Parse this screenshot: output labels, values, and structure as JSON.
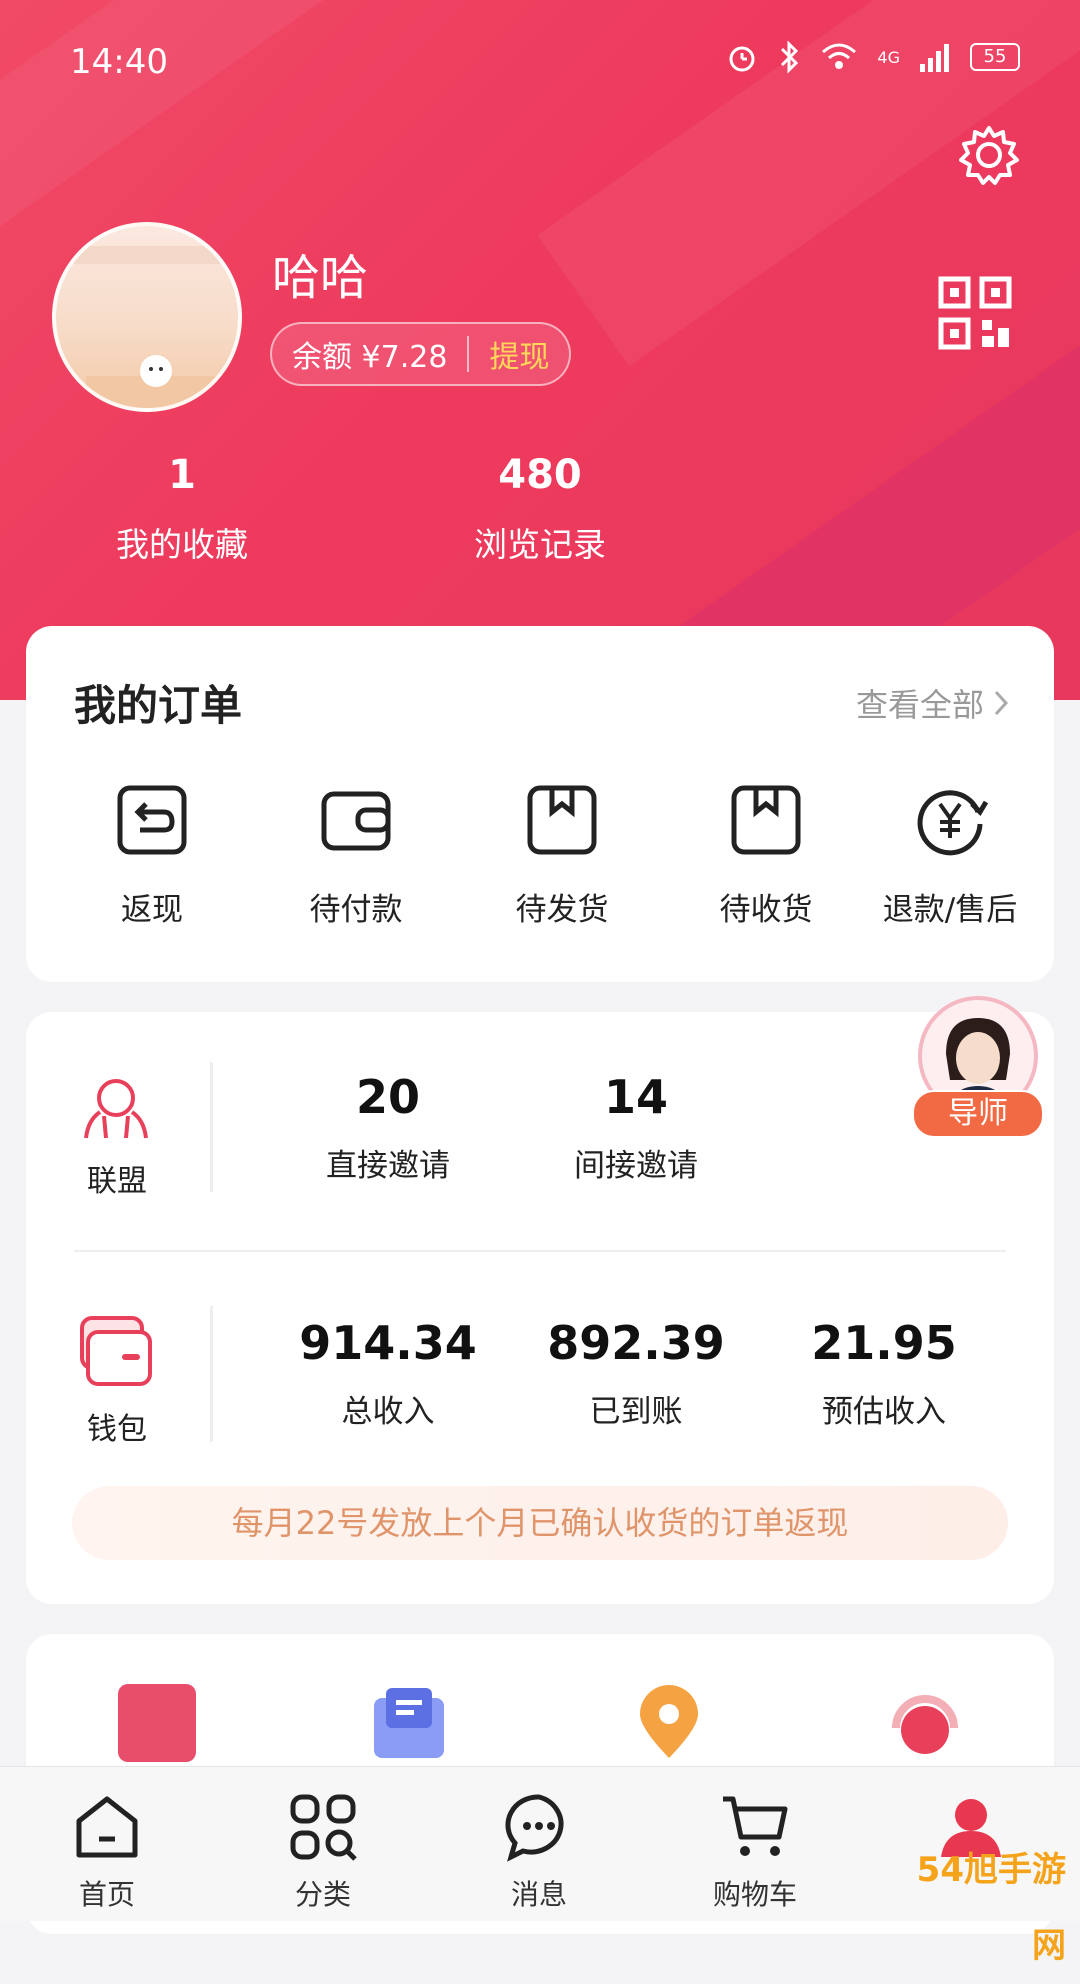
{
  "status_bar": {
    "time": "14:40",
    "battery": "55",
    "network": "4G"
  },
  "profile": {
    "username": "哈哈",
    "balance_label": "余额 ¥7.28",
    "withdraw_label": "提现",
    "stats": [
      {
        "value": "1",
        "label": "我的收藏"
      },
      {
        "value": "480",
        "label": "浏览记录"
      }
    ]
  },
  "orders": {
    "title": "我的订单",
    "view_all": "查看全部",
    "items": [
      {
        "label": "返现",
        "icon": "cashback-icon"
      },
      {
        "label": "待付款",
        "icon": "wallet-icon"
      },
      {
        "label": "待发货",
        "icon": "box-icon"
      },
      {
        "label": "待收货",
        "icon": "box-icon"
      },
      {
        "label": "退款/售后",
        "icon": "refund-icon"
      }
    ]
  },
  "league": {
    "label": "联盟",
    "metrics": [
      {
        "value": "20",
        "label": "直接邀请"
      },
      {
        "value": "14",
        "label": "间接邀请"
      }
    ],
    "mentor_label": "导师"
  },
  "wallet": {
    "label": "钱包",
    "metrics": [
      {
        "value": "914.34",
        "label": "总收入"
      },
      {
        "value": "892.39",
        "label": "已到账"
      },
      {
        "value": "21.95",
        "label": "预估收入"
      }
    ],
    "notice": "每月22号发放上个月已确认收货的订单返现"
  },
  "tabbar": {
    "items": [
      {
        "label": "首页",
        "icon": "home-icon"
      },
      {
        "label": "分类",
        "icon": "category-icon"
      },
      {
        "label": "消息",
        "icon": "message-icon"
      },
      {
        "label": "购物车",
        "icon": "cart-icon"
      },
      {
        "label": "",
        "icon": "profile-icon"
      }
    ]
  },
  "watermark": "54旭手游网",
  "colors": {
    "accent": "#ee3a5d",
    "gold": "#ffd85a",
    "notice_text": "#e0946a",
    "mentor_badge": "#f26a43"
  }
}
